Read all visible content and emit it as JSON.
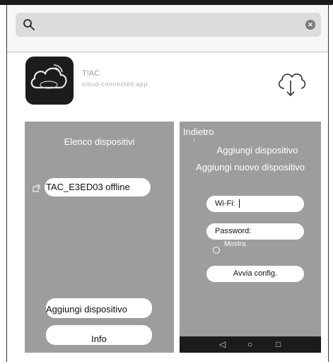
{
  "search": {
    "placeholder": "",
    "value": ""
  },
  "app": {
    "name": "T!AC",
    "developer": "cloud-connected app"
  },
  "left_panel": {
    "title": "Elenco dispositivi",
    "device_label": "TAC_E3ED03  offline",
    "add_device_button": "Aggiungi dispositivo",
    "info_button": "Info"
  },
  "right_panel": {
    "back_label": "Indietro",
    "back_arrow": "‹",
    "heading": "Aggiungi dispositivo",
    "subheading": "Aggiungi nuovo dispositivo",
    "wifi_label": "Wi-Fi:",
    "password_label": "Password:",
    "show_label": "Mostra",
    "start_config_button": "Avvia config."
  },
  "android_nav": {
    "back_glyph": "◁",
    "home_glyph": "○",
    "recents_glyph": "□"
  },
  "icons": [
    "search-icon",
    "clear-icon",
    "app-icon",
    "cloud-download-icon",
    "device-icon",
    "radio-icon"
  ]
}
